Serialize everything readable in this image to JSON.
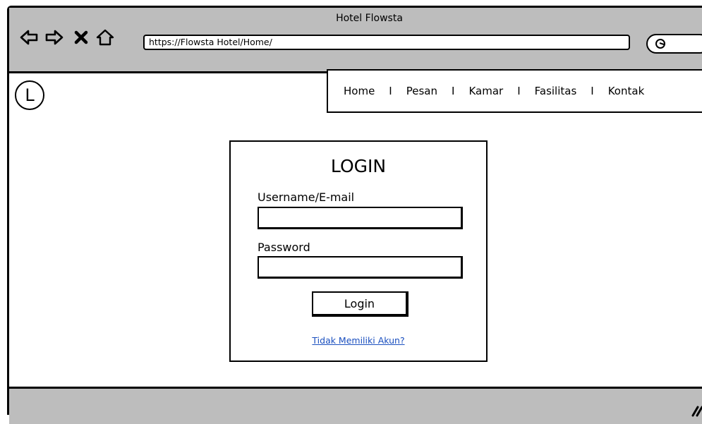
{
  "window": {
    "title": "Hotel Flowsta"
  },
  "browser": {
    "url": "https://Flowsta Hotel/Home/",
    "back_icon": "arrow-left-icon",
    "forward_icon": "arrow-right-icon",
    "stop_icon": "close-x-icon",
    "home_icon": "home-icon",
    "search_icon": "search-icon"
  },
  "site": {
    "logo_letter": "L",
    "nav": {
      "items": [
        "Home",
        "Pesan",
        "Kamar",
        "Fasilitas",
        "Kontak"
      ],
      "separator": "I"
    }
  },
  "login": {
    "title": "LOGIN",
    "username_label": "Username/E-mail",
    "username_value": "",
    "password_label": "Password",
    "password_value": "",
    "button_label": "Login",
    "signup_link": "Tidak Memiliki Akun?"
  },
  "colors": {
    "chrome": "#bdbdbd",
    "link": "#1a4fbf"
  }
}
